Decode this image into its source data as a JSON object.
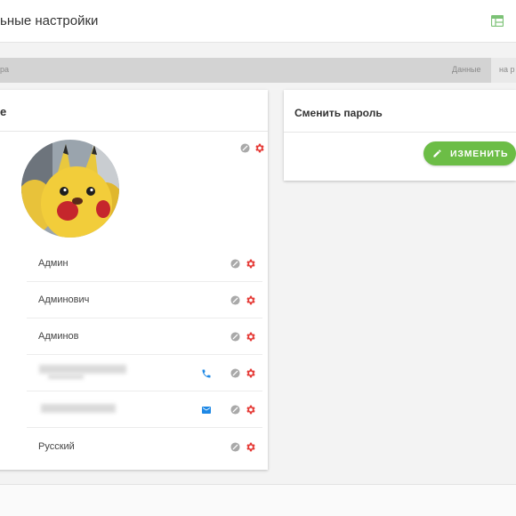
{
  "header": {
    "title": "ьные настройки"
  },
  "strip": {
    "left_label": "ра",
    "data_label": "Данные",
    "tab_label": "на р"
  },
  "profile_card": {
    "title": "е",
    "fields": [
      {
        "value": "Админ"
      },
      {
        "value": "Админович"
      },
      {
        "value": "Админов"
      },
      {
        "value": "",
        "icon": "phone-icon"
      },
      {
        "value": "",
        "icon": "mail-icon"
      },
      {
        "value": "Русский"
      }
    ]
  },
  "password_card": {
    "title": "Сменить пароль",
    "button_label": "ИЗМЕНИТЬ"
  },
  "colors": {
    "accent_green": "#6cbd46",
    "gear_red": "#e53935",
    "contact_blue": "#1e88e5",
    "block_gray": "#a9a9a9"
  }
}
